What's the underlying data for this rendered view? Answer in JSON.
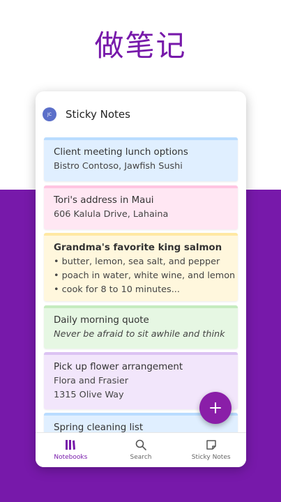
{
  "hero": {
    "title": "做笔记"
  },
  "app": {
    "avatar_initials": "JC",
    "title": "Sticky Notes"
  },
  "notes": [
    {
      "title": "Client meeting lunch options",
      "title_bold": false,
      "lines": [
        "Bistro Contoso, Jawfish Sushi"
      ],
      "italic": false,
      "bg": "#e0efff",
      "accent": "#b9dcff"
    },
    {
      "title": "Tori's address in Maui",
      "title_bold": false,
      "lines": [
        "606 Kalula Drive, Lahaina"
      ],
      "italic": false,
      "bg": "#ffe7f3",
      "accent": "#ffc5e1"
    },
    {
      "title": "Grandma's favorite king salmon",
      "title_bold": true,
      "lines": [
        "• butter, lemon, sea salt, and pepper",
        "• poach in water, white wine, and lemon",
        "• cook for 8 to 10 minutes..."
      ],
      "italic": false,
      "bg": "#fff7dd",
      "accent": "#ffe8a3"
    },
    {
      "title": "Daily morning quote",
      "title_bold": false,
      "lines": [
        "Never be afraid to sit awhile and think"
      ],
      "italic": true,
      "bg": "#e6f7e3",
      "accent": "#c5ebbf"
    },
    {
      "title": "Pick up flower arrangement",
      "title_bold": false,
      "lines": [
        "Flora and Frasier",
        "1315 Olive Way"
      ],
      "italic": false,
      "bg": "#f2e6fb",
      "accent": "#dcc3f3"
    },
    {
      "title": "Spring cleaning list",
      "title_bold": false,
      "lines": [],
      "italic": false,
      "bg": "#e0efff",
      "accent": "#b9dcff"
    }
  ],
  "fab": {
    "icon": "plus-icon",
    "color": "#8a1ea8"
  },
  "nav": [
    {
      "label": "Notebooks",
      "icon": "notebooks-icon",
      "active": true
    },
    {
      "label": "Search",
      "icon": "search-icon",
      "active": false
    },
    {
      "label": "Sticky Notes",
      "icon": "sticky-notes-icon",
      "active": false
    }
  ],
  "colors": {
    "brand_purple": "#7719aa"
  }
}
